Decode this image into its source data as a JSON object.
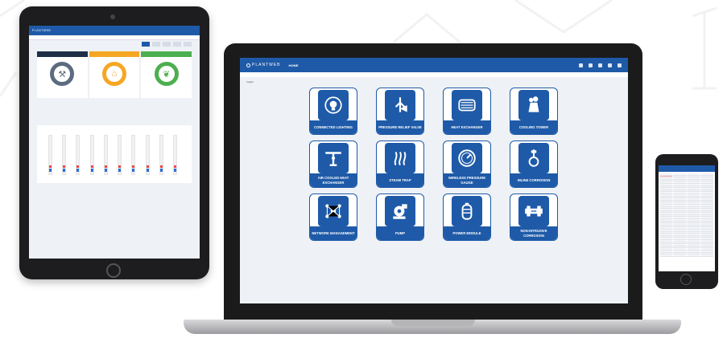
{
  "colors": {
    "brand": "#1e5aa8",
    "header": "#1e5aa8",
    "accent_red": "#e44",
    "accent_blue": "#2b6fd6"
  },
  "app": {
    "brand": "PLANTWEB",
    "page_title": "HOME",
    "subtitle": "Insight"
  },
  "tablet": {
    "gauges": [
      {
        "color": "#1e2f47",
        "ring": "#5b6b80",
        "icon": "tools-icon"
      },
      {
        "color": "#f5a623",
        "ring": "#f5a623",
        "icon": "flame-icon"
      },
      {
        "color": "#4caf50",
        "ring": "#4caf50",
        "icon": "leaf-icon"
      }
    ],
    "bar_count": 10
  },
  "tiles": [
    {
      "label": "CONNECTED LIGHTING",
      "icon": "lightbulb-icon"
    },
    {
      "label": "PRESSURE RELIEF VALVE",
      "icon": "relief-valve-icon"
    },
    {
      "label": "HEAT EXCHANGER",
      "icon": "heat-exchanger-icon"
    },
    {
      "label": "COOLING TOWER",
      "icon": "cooling-tower-icon"
    },
    {
      "label": "AIR COOLED HEAT EXCHANGER",
      "icon": "air-cooled-exchanger-icon"
    },
    {
      "label": "STEAM TRAP",
      "icon": "steam-icon"
    },
    {
      "label": "WIRELESS PRESSURE GAUGE",
      "icon": "pressure-gauge-icon"
    },
    {
      "label": "INLINE CORROSION",
      "icon": "inline-corrosion-icon"
    },
    {
      "label": "NETWORK MANAGEMENT",
      "icon": "network-icon"
    },
    {
      "label": "PUMP",
      "icon": "pump-icon"
    },
    {
      "label": "POWER MODULE",
      "icon": "battery-icon"
    },
    {
      "label": "NON-INTRUSIVE CORROSION",
      "icon": "pipe-corrosion-icon"
    }
  ],
  "phone": {
    "row_count": 40
  }
}
